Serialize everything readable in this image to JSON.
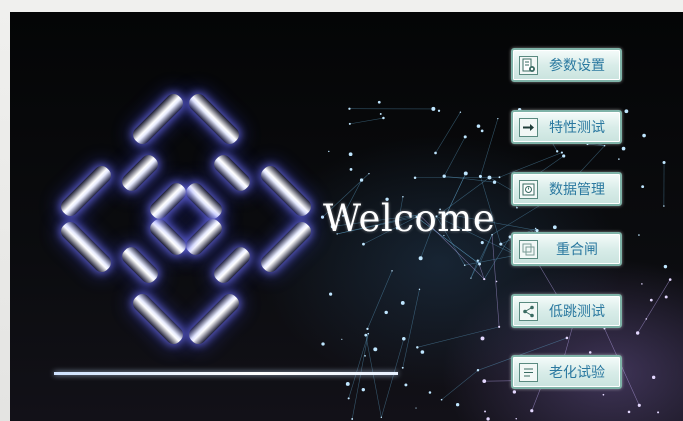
{
  "screen": {
    "welcome_text": "Welcome"
  },
  "menu": {
    "items": [
      {
        "label": "参数设置",
        "icon": "settings-document-icon"
      },
      {
        "label": "特性测试",
        "icon": "arrow-right-icon"
      },
      {
        "label": "数据管理",
        "icon": "data-clock-icon"
      },
      {
        "label": "重合闸",
        "icon": "reclose-icon"
      },
      {
        "label": "低跳测试",
        "icon": "share-nodes-icon"
      },
      {
        "label": "老化试验",
        "icon": "list-icon"
      }
    ]
  },
  "colors": {
    "button_text": "#2b79a0",
    "button_border": "#7fb3a8",
    "glow": "#7a82ff"
  }
}
